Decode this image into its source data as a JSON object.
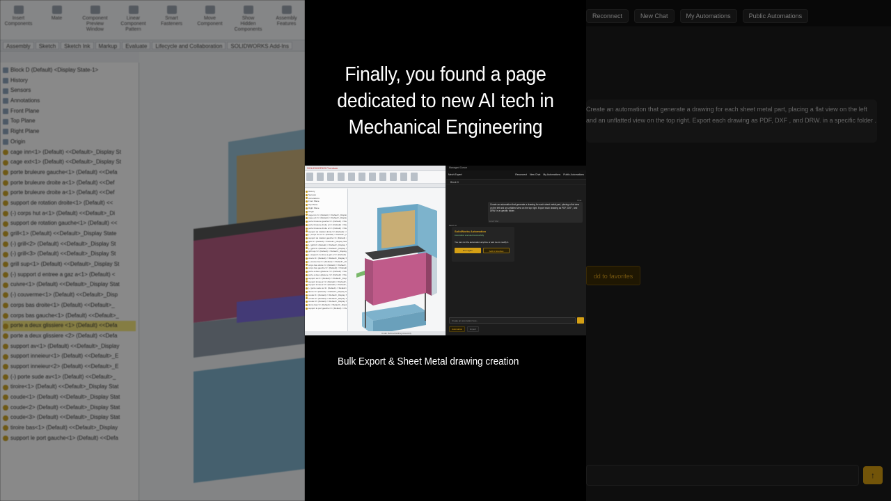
{
  "headline": {
    "line1": "Finally, you found a page",
    "line2": "dedicated to new AI tech in",
    "line3": "Mechanical Engineering"
  },
  "caption": "Bulk Export & Sheet Metal drawing creation",
  "left_bg": {
    "ribbon": [
      "Insert Components",
      "Mate",
      "Component Preview Window",
      "Linear Component Pattern",
      "Smart Fasteners",
      "Move Component",
      "Show Hidden Components",
      "Assembly Features"
    ],
    "tabs": [
      "Assembly",
      "Sketch",
      "Sketch Ink",
      "Markup",
      "Evaluate",
      "Lifecycle and Collaboration",
      "SOLIDWORKS Add-Ins"
    ],
    "tree_root": "Block D (Default) <Display State-1>",
    "tree_items": [
      "History",
      "Sensors",
      "Annotations",
      "Front Plane",
      "Top Plane",
      "Right Plane",
      "Origin",
      "cage inn<1> (Default) <<Default>_Display St",
      "cage ext<1> (Default) <<Default>_Display St",
      "porte bruleure gauche<1> (Default) <<Defa",
      "porte bruleure droite a<1> (Default) <<Def",
      "porte bruleure droite a<1> (Default) <<Def",
      "support de rotation droite<1> (Default) <<",
      "(-) corps hut a<1> (Default) <<Default>_Di",
      "support de rotation gauche<1> (Default) <<",
      "grill<1> (Default) <<Default>_Display State",
      "(-) grill<2> (Default) <<Default>_Display St",
      "(-) grill<3> (Default) <<Default>_Display St",
      "grill sup<1> (Default) <<Default>_Display St",
      "(-) support d entree a gaz a<1> (Default) <",
      "cuivre<1> (Default) <<Default>_Display Stat",
      "(-) couverme<1> (Default) <<Default>_Disp",
      "corps bas droite<1> (Default) <<Default>_",
      "corps bas gauche<1> (Default) <<Default>_",
      "porte a deux glissiere <1> (Default) <<Defa",
      "porte a deux glissiere <2> (Default) <<Defa",
      "support av<1> (Default) <<Default>_Display",
      "support inneieur<1> (Default) <<Default>_E",
      "support inneieur<2> (Default) <<Default>_E",
      "(-) porte sude av<1> (Default) <<Default>_",
      "tiroire<1> (Default) <<Default>_Display Stat",
      "coude<1> (Default) <<Default>_Display Stat",
      "coude<2> (Default) <<Default>_Display Stat",
      "coude<3> (Default) <<Default>_Display Stat",
      "tiroire bas<1> (Default) <<Default>_Display",
      "support le port gauche<1> (Default) <<Defa"
    ]
  },
  "right_bg": {
    "top_buttons": [
      "Reconnect",
      "New Chat",
      "My Automations",
      "Public Automations"
    ],
    "user_label": "Chat",
    "user_message": "Create an automation that generate a drawing for each sheet metal part, placing a flat view on the left and an unflatted view on the top right. Export each drawing as PDF, DXF , and DRW. in a specific folder .",
    "time": "10:27 PM",
    "bot_title_partial": "on",
    "bot_desc_partial": "sk me to modify it.",
    "favorites_partial": "dd to favorites"
  },
  "mini_app": {
    "window_title": "Managed Cursor",
    "app_title": "Mech Expert",
    "top_buttons": [
      "Reconnect",
      "New Chat",
      "My Automations",
      "Public Automations"
    ],
    "crumb": "Block D",
    "user_label": "Chat",
    "user_message": "Create an automation that generate a drawing for each sheet metal part, placing a flat view on the left and an unflatted view on the top right. Export each drawing as PDF, DXF , and DRW. in a specific folder .",
    "time": "10:27 PM",
    "bot_label": "Mech AI",
    "bot_title": "SolidWorks Automation",
    "bot_status": "Automation executed successfully",
    "bot_section": "SolidWorks Automation",
    "bot_desc": "You can run the automation anytime or ask me to modify it.",
    "run_label": "Run again",
    "fav_label": "Add to favorites",
    "bot_time": "10:27 PM",
    "input_placeholder": "Create an automation here...",
    "chips": [
      "Automation",
      "Expert"
    ]
  },
  "mini_cad": {
    "title": "SOLIDWORKS Premium",
    "status": "Under Defined    Editing Assembly"
  }
}
